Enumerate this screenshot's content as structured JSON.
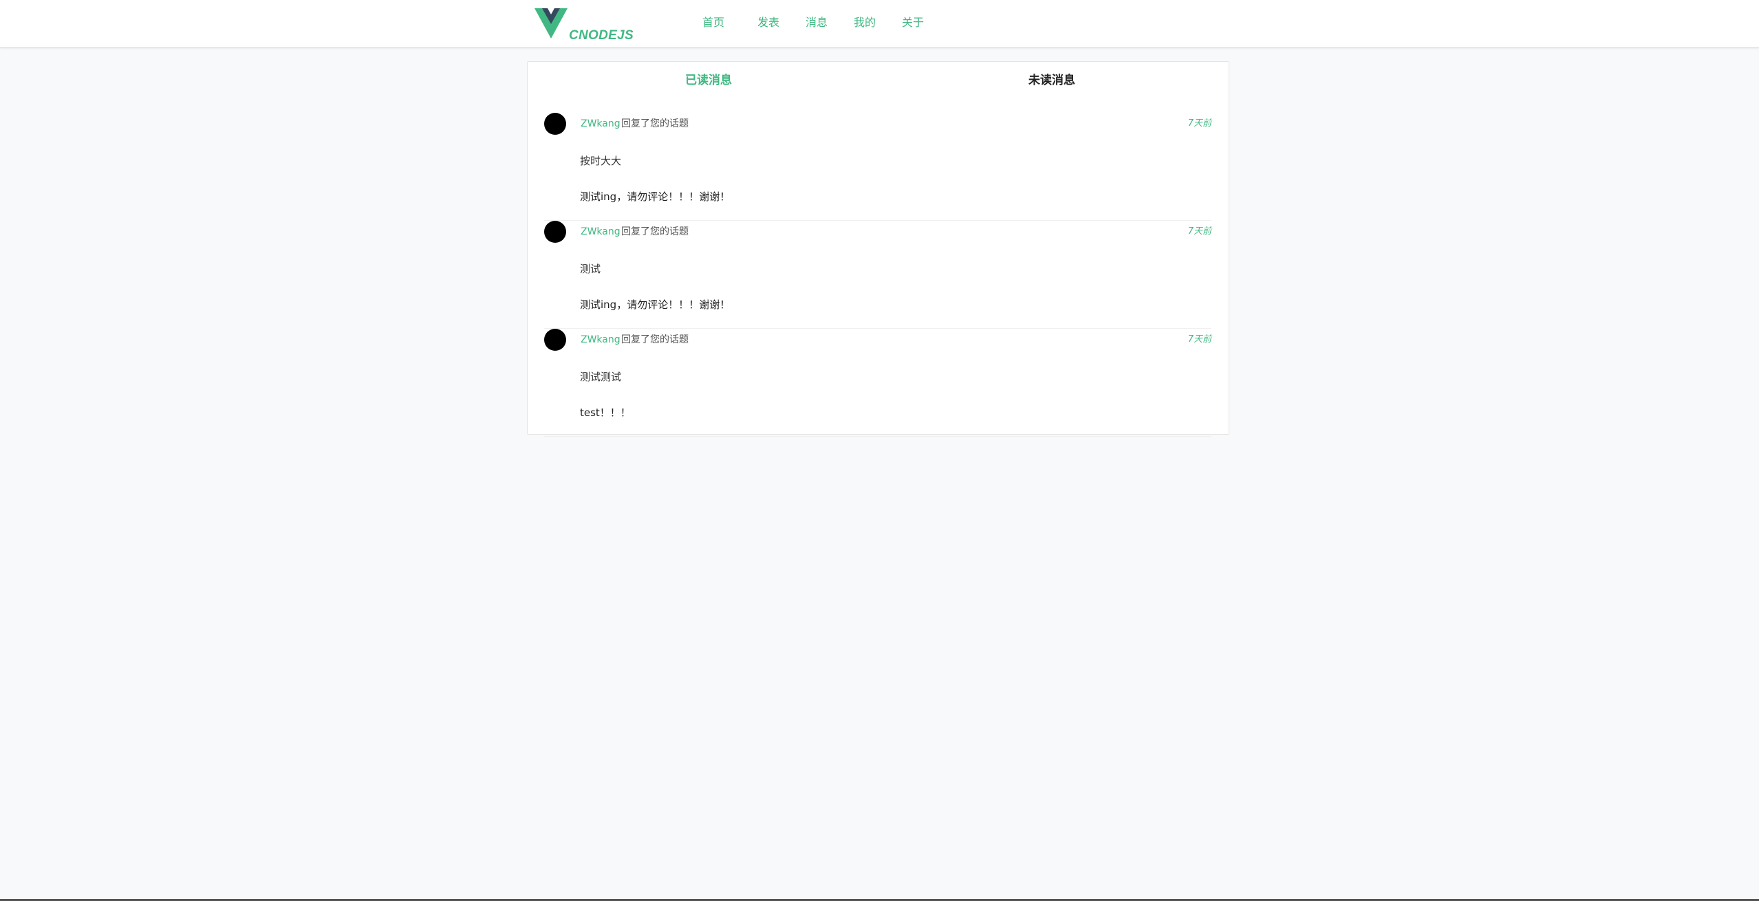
{
  "header": {
    "logo_text": "CNODEJS",
    "logo_colors": {
      "outer": "#41b883",
      "inner": "#35495e"
    },
    "nav": [
      {
        "label": "首页"
      },
      {
        "label": "发表"
      },
      {
        "label": "消息"
      },
      {
        "label": "我的"
      },
      {
        "label": "关于"
      }
    ]
  },
  "tabs": {
    "read_label": "已读消息",
    "unread_label": "未读消息",
    "active": "read"
  },
  "messages": [
    {
      "user": "ZWkang",
      "action": "回复了您的话题",
      "time": "7天前",
      "reply": "按时大大",
      "topic": "测试ing，请勿评论！！！谢谢！"
    },
    {
      "user": "ZWkang",
      "action": "回复了您的话题",
      "time": "7天前",
      "reply": "测试",
      "topic": "测试ing，请勿评论！！！谢谢！"
    },
    {
      "user": "ZWkang",
      "action": "回复了您的话题",
      "time": "7天前",
      "reply": "测试测试",
      "topic": "test！！！"
    }
  ],
  "colors": {
    "accent": "#41b883",
    "background": "#f8f9fb",
    "avatar": "#000000"
  }
}
